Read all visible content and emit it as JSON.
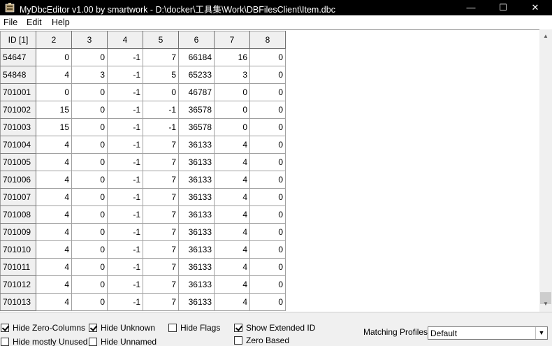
{
  "window": {
    "title": "MyDbcEditor v1.00 by smartwork - D:\\docker\\工具集\\Work\\DBFilesClient\\Item.dbc",
    "minimize_glyph": "—",
    "maximize_glyph": "☐",
    "close_glyph": "✕"
  },
  "menu": [
    "File",
    "Edit",
    "Help"
  ],
  "grid": {
    "columns": [
      "ID [1]",
      "2",
      "3",
      "4",
      "5",
      "6",
      "7",
      "8"
    ],
    "rows": [
      [
        "54647",
        "0",
        "0",
        "-1",
        "7",
        "66184",
        "16",
        "0"
      ],
      [
        "54848",
        "4",
        "3",
        "-1",
        "5",
        "65233",
        "3",
        "0"
      ],
      [
        "701001",
        "0",
        "0",
        "-1",
        "0",
        "46787",
        "0",
        "0"
      ],
      [
        "701002",
        "15",
        "0",
        "-1",
        "-1",
        "36578",
        "0",
        "0"
      ],
      [
        "701003",
        "15",
        "0",
        "-1",
        "-1",
        "36578",
        "0",
        "0"
      ],
      [
        "701004",
        "4",
        "0",
        "-1",
        "7",
        "36133",
        "4",
        "0"
      ],
      [
        "701005",
        "4",
        "0",
        "-1",
        "7",
        "36133",
        "4",
        "0"
      ],
      [
        "701006",
        "4",
        "0",
        "-1",
        "7",
        "36133",
        "4",
        "0"
      ],
      [
        "701007",
        "4",
        "0",
        "-1",
        "7",
        "36133",
        "4",
        "0"
      ],
      [
        "701008",
        "4",
        "0",
        "-1",
        "7",
        "36133",
        "4",
        "0"
      ],
      [
        "701009",
        "4",
        "0",
        "-1",
        "7",
        "36133",
        "4",
        "0"
      ],
      [
        "701010",
        "4",
        "0",
        "-1",
        "7",
        "36133",
        "4",
        "0"
      ],
      [
        "701011",
        "4",
        "0",
        "-1",
        "7",
        "36133",
        "4",
        "0"
      ],
      [
        "701012",
        "4",
        "0",
        "-1",
        "7",
        "36133",
        "4",
        "0"
      ],
      [
        "701013",
        "4",
        "0",
        "-1",
        "7",
        "36133",
        "4",
        "0"
      ]
    ]
  },
  "options": {
    "hide_zero_columns": {
      "label": "Hide Zero-Columns",
      "checked": true
    },
    "hide_mostly_unused": {
      "label": "Hide mostly Unused",
      "checked": false
    },
    "hide_unknown": {
      "label": "Hide Unknown",
      "checked": true
    },
    "hide_unnamed": {
      "label": "Hide Unnamed",
      "checked": false
    },
    "hide_flags": {
      "label": "Hide Flags",
      "checked": false
    },
    "show_extended_id": {
      "label": "Show Extended ID",
      "checked": true
    },
    "zero_based": {
      "label": "Zero Based",
      "checked": false
    }
  },
  "profiles": {
    "label": "Matching Profiles:",
    "selected": "Default"
  },
  "colors": {
    "titlebar_bg": "#000000",
    "header_bg": "#f0f0f0",
    "grid_bg": "#ffffff",
    "grid_line": "#a0a0a0"
  },
  "icons": {
    "app": "app-icon",
    "scroll_up": "chevron-up-icon",
    "scroll_down": "chevron-down-icon",
    "dropdown": "chevron-down-icon"
  }
}
